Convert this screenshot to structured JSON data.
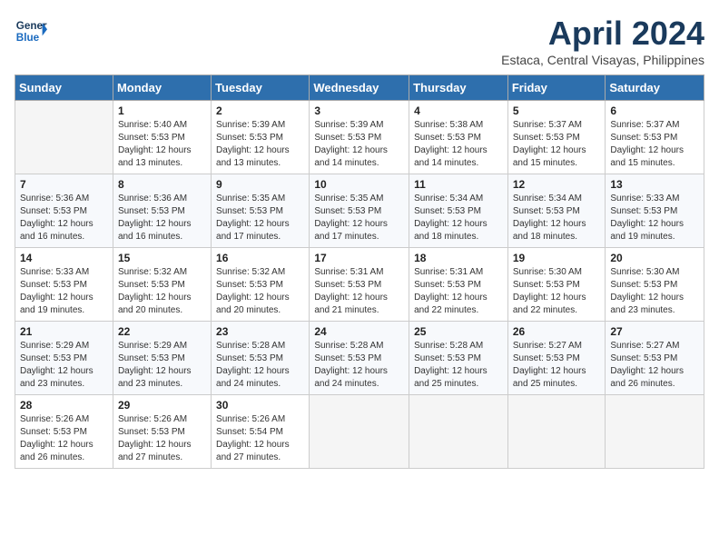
{
  "header": {
    "logo_line1": "General",
    "logo_line2": "Blue",
    "title": "April 2024",
    "subtitle": "Estaca, Central Visayas, Philippines"
  },
  "days_of_week": [
    "Sunday",
    "Monday",
    "Tuesday",
    "Wednesday",
    "Thursday",
    "Friday",
    "Saturday"
  ],
  "weeks": [
    [
      {
        "day": "",
        "info": ""
      },
      {
        "day": "1",
        "info": "Sunrise: 5:40 AM\nSunset: 5:53 PM\nDaylight: 12 hours\nand 13 minutes."
      },
      {
        "day": "2",
        "info": "Sunrise: 5:39 AM\nSunset: 5:53 PM\nDaylight: 12 hours\nand 13 minutes."
      },
      {
        "day": "3",
        "info": "Sunrise: 5:39 AM\nSunset: 5:53 PM\nDaylight: 12 hours\nand 14 minutes."
      },
      {
        "day": "4",
        "info": "Sunrise: 5:38 AM\nSunset: 5:53 PM\nDaylight: 12 hours\nand 14 minutes."
      },
      {
        "day": "5",
        "info": "Sunrise: 5:37 AM\nSunset: 5:53 PM\nDaylight: 12 hours\nand 15 minutes."
      },
      {
        "day": "6",
        "info": "Sunrise: 5:37 AM\nSunset: 5:53 PM\nDaylight: 12 hours\nand 15 minutes."
      }
    ],
    [
      {
        "day": "7",
        "info": "Sunrise: 5:36 AM\nSunset: 5:53 PM\nDaylight: 12 hours\nand 16 minutes."
      },
      {
        "day": "8",
        "info": "Sunrise: 5:36 AM\nSunset: 5:53 PM\nDaylight: 12 hours\nand 16 minutes."
      },
      {
        "day": "9",
        "info": "Sunrise: 5:35 AM\nSunset: 5:53 PM\nDaylight: 12 hours\nand 17 minutes."
      },
      {
        "day": "10",
        "info": "Sunrise: 5:35 AM\nSunset: 5:53 PM\nDaylight: 12 hours\nand 17 minutes."
      },
      {
        "day": "11",
        "info": "Sunrise: 5:34 AM\nSunset: 5:53 PM\nDaylight: 12 hours\nand 18 minutes."
      },
      {
        "day": "12",
        "info": "Sunrise: 5:34 AM\nSunset: 5:53 PM\nDaylight: 12 hours\nand 18 minutes."
      },
      {
        "day": "13",
        "info": "Sunrise: 5:33 AM\nSunset: 5:53 PM\nDaylight: 12 hours\nand 19 minutes."
      }
    ],
    [
      {
        "day": "14",
        "info": "Sunrise: 5:33 AM\nSunset: 5:53 PM\nDaylight: 12 hours\nand 19 minutes."
      },
      {
        "day": "15",
        "info": "Sunrise: 5:32 AM\nSunset: 5:53 PM\nDaylight: 12 hours\nand 20 minutes."
      },
      {
        "day": "16",
        "info": "Sunrise: 5:32 AM\nSunset: 5:53 PM\nDaylight: 12 hours\nand 20 minutes."
      },
      {
        "day": "17",
        "info": "Sunrise: 5:31 AM\nSunset: 5:53 PM\nDaylight: 12 hours\nand 21 minutes."
      },
      {
        "day": "18",
        "info": "Sunrise: 5:31 AM\nSunset: 5:53 PM\nDaylight: 12 hours\nand 22 minutes."
      },
      {
        "day": "19",
        "info": "Sunrise: 5:30 AM\nSunset: 5:53 PM\nDaylight: 12 hours\nand 22 minutes."
      },
      {
        "day": "20",
        "info": "Sunrise: 5:30 AM\nSunset: 5:53 PM\nDaylight: 12 hours\nand 23 minutes."
      }
    ],
    [
      {
        "day": "21",
        "info": "Sunrise: 5:29 AM\nSunset: 5:53 PM\nDaylight: 12 hours\nand 23 minutes."
      },
      {
        "day": "22",
        "info": "Sunrise: 5:29 AM\nSunset: 5:53 PM\nDaylight: 12 hours\nand 23 minutes."
      },
      {
        "day": "23",
        "info": "Sunrise: 5:28 AM\nSunset: 5:53 PM\nDaylight: 12 hours\nand 24 minutes."
      },
      {
        "day": "24",
        "info": "Sunrise: 5:28 AM\nSunset: 5:53 PM\nDaylight: 12 hours\nand 24 minutes."
      },
      {
        "day": "25",
        "info": "Sunrise: 5:28 AM\nSunset: 5:53 PM\nDaylight: 12 hours\nand 25 minutes."
      },
      {
        "day": "26",
        "info": "Sunrise: 5:27 AM\nSunset: 5:53 PM\nDaylight: 12 hours\nand 25 minutes."
      },
      {
        "day": "27",
        "info": "Sunrise: 5:27 AM\nSunset: 5:53 PM\nDaylight: 12 hours\nand 26 minutes."
      }
    ],
    [
      {
        "day": "28",
        "info": "Sunrise: 5:26 AM\nSunset: 5:53 PM\nDaylight: 12 hours\nand 26 minutes."
      },
      {
        "day": "29",
        "info": "Sunrise: 5:26 AM\nSunset: 5:53 PM\nDaylight: 12 hours\nand 27 minutes."
      },
      {
        "day": "30",
        "info": "Sunrise: 5:26 AM\nSunset: 5:54 PM\nDaylight: 12 hours\nand 27 minutes."
      },
      {
        "day": "",
        "info": ""
      },
      {
        "day": "",
        "info": ""
      },
      {
        "day": "",
        "info": ""
      },
      {
        "day": "",
        "info": ""
      }
    ]
  ]
}
